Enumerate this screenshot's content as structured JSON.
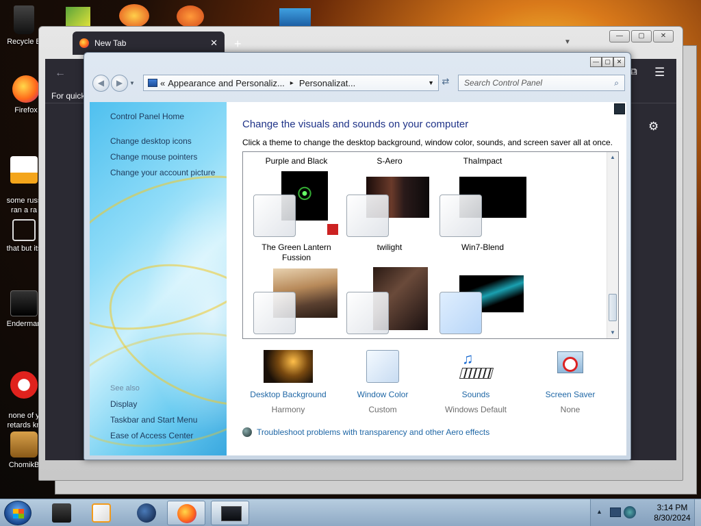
{
  "desktop": {
    "icons": [
      {
        "label": "Recycle B",
        "icon": "recycle-bin-icon"
      },
      {
        "label": "Firefox",
        "icon": "firefox-icon"
      },
      {
        "label": "some russ\nran a ra",
        "icon": "file-icon"
      },
      {
        "label": "that but its",
        "icon": "folder-icon"
      },
      {
        "label": "Enderman",
        "icon": "app-icon"
      },
      {
        "label": "none of y\nretards kn",
        "icon": "opera-icon"
      },
      {
        "label": "ChomikB",
        "icon": "chomik-icon"
      }
    ]
  },
  "firefox": {
    "tab_title": "New Tab",
    "tab_close": "✕",
    "new_tab": "+",
    "quick_text": "For quick",
    "back": "←",
    "menu": "☰",
    "gear": "⚙",
    "extensions": "⧉"
  },
  "control_panel": {
    "window_buttons": {
      "minimize": "—",
      "maximize": "▢",
      "close": "✕"
    },
    "address": {
      "chevron": "«",
      "crumb1": "Appearance and Personaliz...",
      "sep": "▸",
      "crumb2": "Personalizat...",
      "dropdown": "▼"
    },
    "refresh": "⇄",
    "search_placeholder": "Search Control Panel",
    "search_icon": "⌕",
    "sidebar": {
      "home": "Control Panel Home",
      "links": [
        "Change desktop icons",
        "Change mouse pointers",
        "Change your account picture"
      ],
      "see_also_heading": "See also",
      "see_also": [
        "Display",
        "Taskbar and Start Menu",
        "Ease of Access Center"
      ]
    },
    "main": {
      "title": "Change the visuals and sounds on your computer",
      "description": "Click a theme to change the desktop background, window color, sounds, and screen saver all at once.",
      "themes_top_row_labels": [
        "Purple and Black",
        "S-Aero",
        "ThaImpact"
      ],
      "themes_middle_labels": [
        "The Green Lantern\nFussion",
        "twilight",
        "Win7-Blend"
      ],
      "scroll_up": "▲",
      "scroll_down": "▼",
      "settings": [
        {
          "name": "Desktop Background",
          "value": "Harmony"
        },
        {
          "name": "Window Color",
          "value": "Custom"
        },
        {
          "name": "Sounds",
          "value": "Windows Default"
        },
        {
          "name": "Screen Saver",
          "value": "None"
        }
      ],
      "troubleshoot": "Troubleshoot problems with transparency and other Aero effects"
    }
  },
  "taskbar": {
    "time": "3:14 PM",
    "date": "8/30/2024",
    "tray_arrow": "▲"
  }
}
